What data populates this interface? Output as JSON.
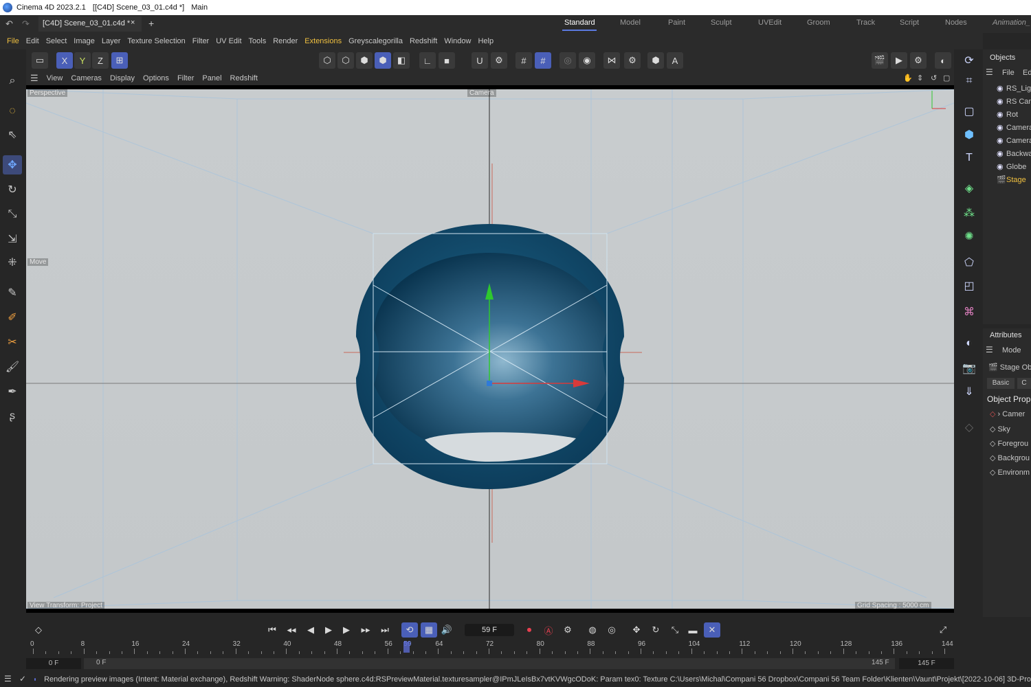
{
  "titlebar": {
    "app": "Cinema 4D 2023.2.1",
    "doc": "[[C4D] Scene_03_01.c4d *]",
    "section": "Main"
  },
  "doctab": {
    "label": "[C4D] Scene_03_01.c4d *",
    "close": "×",
    "add": "+"
  },
  "layouts": [
    "Standard",
    "Model",
    "Paint",
    "Sculpt",
    "UVEdit",
    "Groom",
    "Track",
    "Script",
    "Nodes",
    "Animation_"
  ],
  "menu": [
    "File",
    "Edit",
    "Select",
    "Image",
    "Layer",
    "Texture Selection",
    "Filter",
    "UV Edit",
    "Tools",
    "Render",
    "Extensions",
    "Greyscalegorilla",
    "Redshift",
    "Window",
    "Help"
  ],
  "axes": {
    "x": "X",
    "y": "Y",
    "z": "Z"
  },
  "viewport_menu": [
    "View",
    "Cameras",
    "Display",
    "Options",
    "Filter",
    "Panel",
    "Redshift"
  ],
  "viewport": {
    "name": "Perspective",
    "camera": "Camera",
    "hud_move": "Move",
    "view_transform": "View Transform: Project",
    "grid_spacing": "Grid Spacing : 5000 cm"
  },
  "objects_panel": {
    "title": "Objects",
    "menu": [
      "File",
      "Ed"
    ],
    "items": [
      {
        "label": "RS_Ligh",
        "icon": "light-icon"
      },
      {
        "label": "RS Cam",
        "icon": "camera-icon"
      },
      {
        "label": "Rot",
        "icon": "null-icon"
      },
      {
        "label": "Camera",
        "icon": "camera-icon"
      },
      {
        "label": "Camera",
        "icon": "camera-icon"
      },
      {
        "label": "Backwa",
        "icon": "null-icon"
      },
      {
        "label": "Globe",
        "icon": "null-icon"
      },
      {
        "label": "Stage",
        "icon": "stage-icon",
        "selected": true
      }
    ]
  },
  "attributes_panel": {
    "title": "Attributes",
    "mode": "Mode",
    "object": "Stage Ob",
    "tabs": [
      "Basic",
      "C"
    ],
    "section": "Object Prop",
    "props": [
      "Camer",
      "Sky",
      "Foregrou",
      "Backgrou",
      "Environm"
    ]
  },
  "timeline": {
    "current_frame": "59 F",
    "ticks": [
      "0",
      "8",
      "16",
      "24",
      "32",
      "40",
      "48",
      "56",
      "59",
      "64",
      "72",
      "80",
      "88",
      "96",
      "104",
      "112",
      "120",
      "128",
      "136",
      "144"
    ],
    "range_start": "0 F",
    "range_start2": "0 F",
    "range_end": "145 F",
    "range_end2": "145 F",
    "playhead_frame": 59,
    "max_frame": 144
  },
  "status": {
    "message": "Rendering preview images (Intent: Material exchange), Redshift Warning: ShaderNode sphere.c4d:RSPreviewMaterial.texturesampler@IPmJLeIsBx7vtKVWgcODoK: Param tex0: Texture C:\\Users\\Michal\\Compani 56 Dropbox\\Compani 56 Team Folder\\Klienten\\Vaunt\\Projekt\\[2022-10-06] 3D-Pro"
  },
  "colors": {
    "accent": "#5b7ae0",
    "axis_x": "#c83a3a",
    "axis_y": "#3ac83a",
    "axis_z": "#3a6ac8",
    "sphere": "#0d4a6a",
    "extensions": "#f0c040",
    "record": "#e84050"
  }
}
